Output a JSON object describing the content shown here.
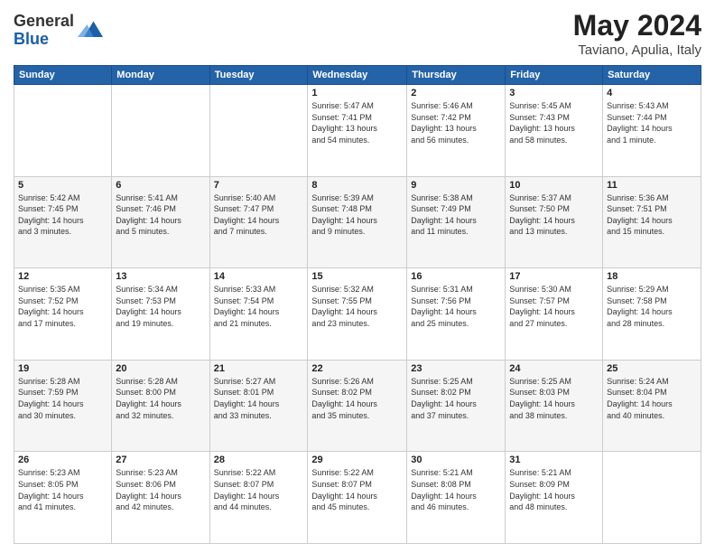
{
  "logo": {
    "general": "General",
    "blue": "Blue"
  },
  "header": {
    "month_year": "May 2024",
    "location": "Taviano, Apulia, Italy"
  },
  "days_of_week": [
    "Sunday",
    "Monday",
    "Tuesday",
    "Wednesday",
    "Thursday",
    "Friday",
    "Saturday"
  ],
  "weeks": [
    [
      {
        "day": "",
        "info": ""
      },
      {
        "day": "",
        "info": ""
      },
      {
        "day": "",
        "info": ""
      },
      {
        "day": "1",
        "info": "Sunrise: 5:47 AM\nSunset: 7:41 PM\nDaylight: 13 hours\nand 54 minutes."
      },
      {
        "day": "2",
        "info": "Sunrise: 5:46 AM\nSunset: 7:42 PM\nDaylight: 13 hours\nand 56 minutes."
      },
      {
        "day": "3",
        "info": "Sunrise: 5:45 AM\nSunset: 7:43 PM\nDaylight: 13 hours\nand 58 minutes."
      },
      {
        "day": "4",
        "info": "Sunrise: 5:43 AM\nSunset: 7:44 PM\nDaylight: 14 hours\nand 1 minute."
      }
    ],
    [
      {
        "day": "5",
        "info": "Sunrise: 5:42 AM\nSunset: 7:45 PM\nDaylight: 14 hours\nand 3 minutes."
      },
      {
        "day": "6",
        "info": "Sunrise: 5:41 AM\nSunset: 7:46 PM\nDaylight: 14 hours\nand 5 minutes."
      },
      {
        "day": "7",
        "info": "Sunrise: 5:40 AM\nSunset: 7:47 PM\nDaylight: 14 hours\nand 7 minutes."
      },
      {
        "day": "8",
        "info": "Sunrise: 5:39 AM\nSunset: 7:48 PM\nDaylight: 14 hours\nand 9 minutes."
      },
      {
        "day": "9",
        "info": "Sunrise: 5:38 AM\nSunset: 7:49 PM\nDaylight: 14 hours\nand 11 minutes."
      },
      {
        "day": "10",
        "info": "Sunrise: 5:37 AM\nSunset: 7:50 PM\nDaylight: 14 hours\nand 13 minutes."
      },
      {
        "day": "11",
        "info": "Sunrise: 5:36 AM\nSunset: 7:51 PM\nDaylight: 14 hours\nand 15 minutes."
      }
    ],
    [
      {
        "day": "12",
        "info": "Sunrise: 5:35 AM\nSunset: 7:52 PM\nDaylight: 14 hours\nand 17 minutes."
      },
      {
        "day": "13",
        "info": "Sunrise: 5:34 AM\nSunset: 7:53 PM\nDaylight: 14 hours\nand 19 minutes."
      },
      {
        "day": "14",
        "info": "Sunrise: 5:33 AM\nSunset: 7:54 PM\nDaylight: 14 hours\nand 21 minutes."
      },
      {
        "day": "15",
        "info": "Sunrise: 5:32 AM\nSunset: 7:55 PM\nDaylight: 14 hours\nand 23 minutes."
      },
      {
        "day": "16",
        "info": "Sunrise: 5:31 AM\nSunset: 7:56 PM\nDaylight: 14 hours\nand 25 minutes."
      },
      {
        "day": "17",
        "info": "Sunrise: 5:30 AM\nSunset: 7:57 PM\nDaylight: 14 hours\nand 27 minutes."
      },
      {
        "day": "18",
        "info": "Sunrise: 5:29 AM\nSunset: 7:58 PM\nDaylight: 14 hours\nand 28 minutes."
      }
    ],
    [
      {
        "day": "19",
        "info": "Sunrise: 5:28 AM\nSunset: 7:59 PM\nDaylight: 14 hours\nand 30 minutes."
      },
      {
        "day": "20",
        "info": "Sunrise: 5:28 AM\nSunset: 8:00 PM\nDaylight: 14 hours\nand 32 minutes."
      },
      {
        "day": "21",
        "info": "Sunrise: 5:27 AM\nSunset: 8:01 PM\nDaylight: 14 hours\nand 33 minutes."
      },
      {
        "day": "22",
        "info": "Sunrise: 5:26 AM\nSunset: 8:02 PM\nDaylight: 14 hours\nand 35 minutes."
      },
      {
        "day": "23",
        "info": "Sunrise: 5:25 AM\nSunset: 8:02 PM\nDaylight: 14 hours\nand 37 minutes."
      },
      {
        "day": "24",
        "info": "Sunrise: 5:25 AM\nSunset: 8:03 PM\nDaylight: 14 hours\nand 38 minutes."
      },
      {
        "day": "25",
        "info": "Sunrise: 5:24 AM\nSunset: 8:04 PM\nDaylight: 14 hours\nand 40 minutes."
      }
    ],
    [
      {
        "day": "26",
        "info": "Sunrise: 5:23 AM\nSunset: 8:05 PM\nDaylight: 14 hours\nand 41 minutes."
      },
      {
        "day": "27",
        "info": "Sunrise: 5:23 AM\nSunset: 8:06 PM\nDaylight: 14 hours\nand 42 minutes."
      },
      {
        "day": "28",
        "info": "Sunrise: 5:22 AM\nSunset: 8:07 PM\nDaylight: 14 hours\nand 44 minutes."
      },
      {
        "day": "29",
        "info": "Sunrise: 5:22 AM\nSunset: 8:07 PM\nDaylight: 14 hours\nand 45 minutes."
      },
      {
        "day": "30",
        "info": "Sunrise: 5:21 AM\nSunset: 8:08 PM\nDaylight: 14 hours\nand 46 minutes."
      },
      {
        "day": "31",
        "info": "Sunrise: 5:21 AM\nSunset: 8:09 PM\nDaylight: 14 hours\nand 48 minutes."
      },
      {
        "day": "",
        "info": ""
      }
    ]
  ]
}
